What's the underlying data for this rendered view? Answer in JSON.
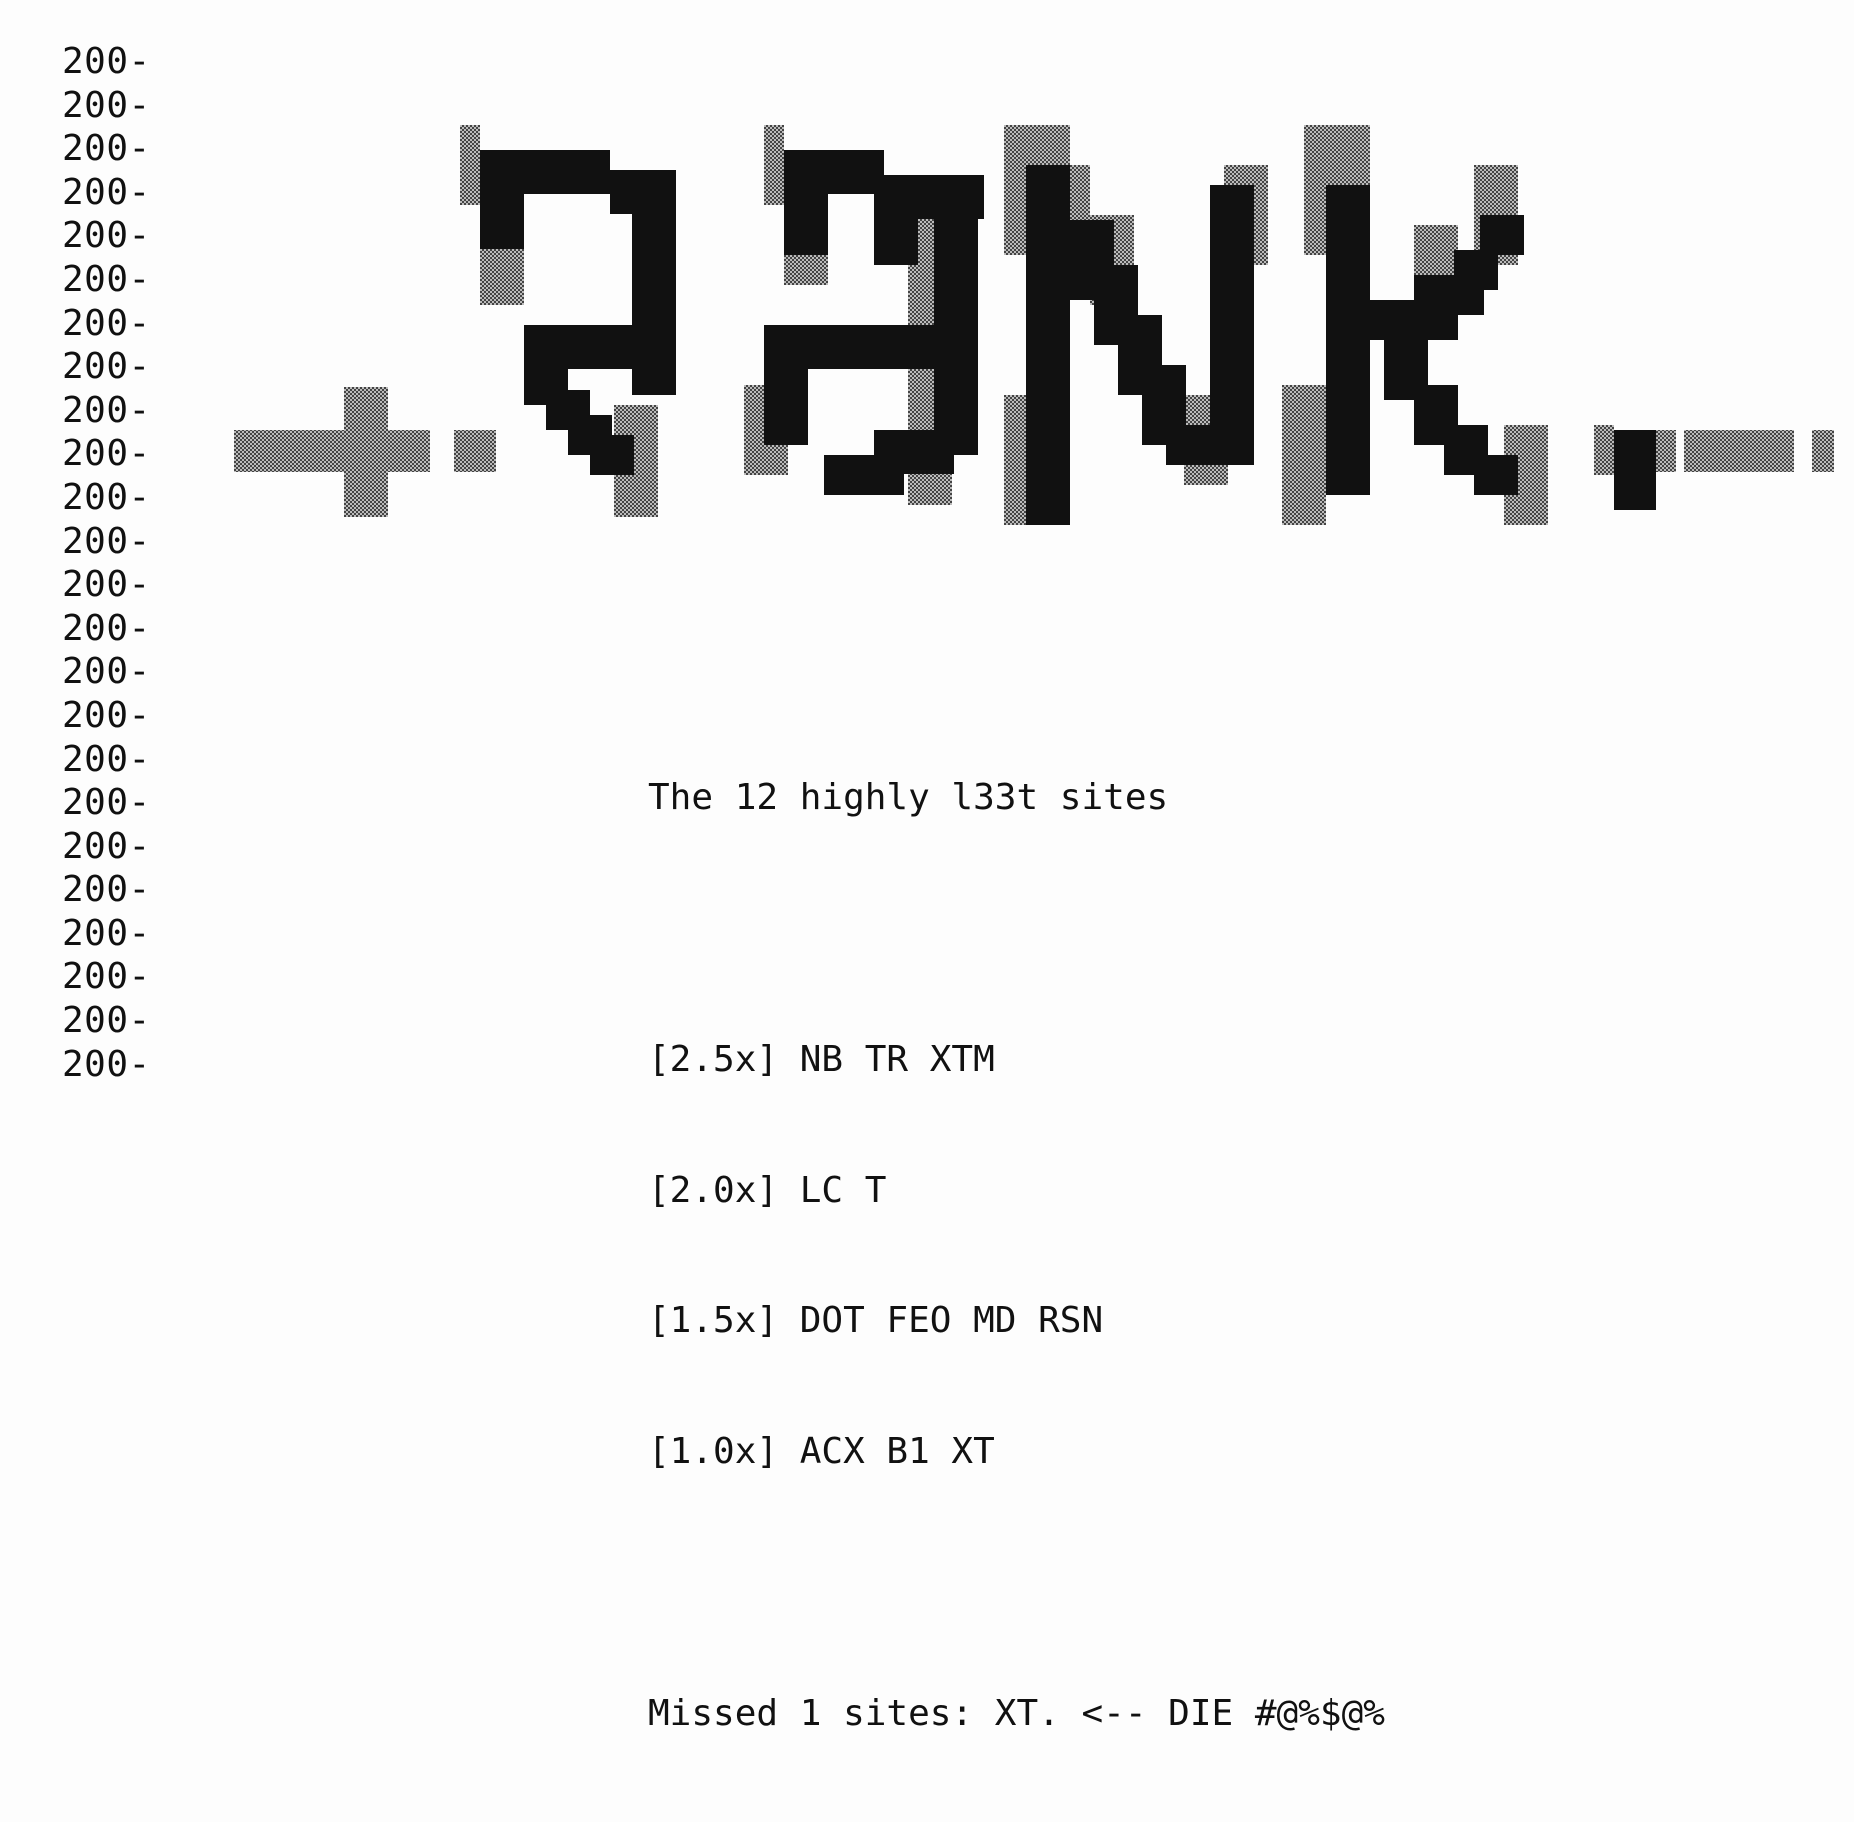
{
  "terminal": {
    "gutter_label": "200-",
    "gutter_row_count": 24,
    "gutter_trailing": "---"
  },
  "banner": {
    "text": ".RBNK."
  },
  "message": {
    "title": "The 12 highly l33t sites",
    "tiers": [
      "[2.5x] NB TR XTM",
      "[2.0x] LC T",
      "[1.5x] DOT FEO MD RSN",
      "[1.0x] ACX B1 XT"
    ],
    "missed": "Missed 1 sites: XT. <-- DIE #@%$@%"
  }
}
